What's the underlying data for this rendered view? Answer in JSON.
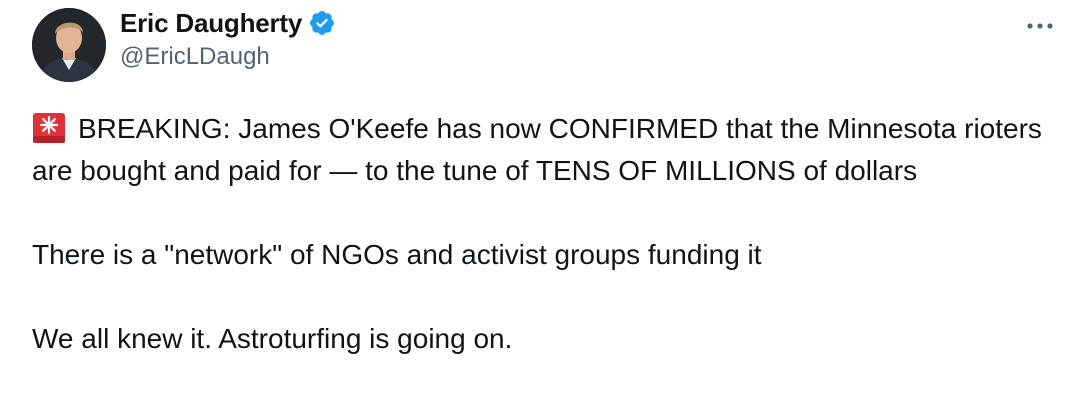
{
  "author": {
    "display_name": "Eric Daugherty",
    "handle": "@EricLDaugh",
    "verified_icon": "verified-badge-icon",
    "avatar_icon": "avatar"
  },
  "menu": {
    "more_icon": "more-options-icon"
  },
  "tweet": {
    "paragraphs": [
      {
        "emoji_icon": "rotating-light-icon",
        "text": "BREAKING: James O'Keefe has now CONFIRMED that the Minnesota rioters are bought and paid for — to the tune of TENS OF MILLIONS of dollars"
      },
      {
        "text": "There is a \"network\" of NGOs and activist groups funding it"
      },
      {
        "text": "We all knew it. Astroturfing is going on."
      }
    ]
  },
  "colors": {
    "text_primary": "#0f1419",
    "text_secondary": "#536471",
    "verified_blue": "#1d9bf0",
    "alarm_red": "#e0323a"
  }
}
